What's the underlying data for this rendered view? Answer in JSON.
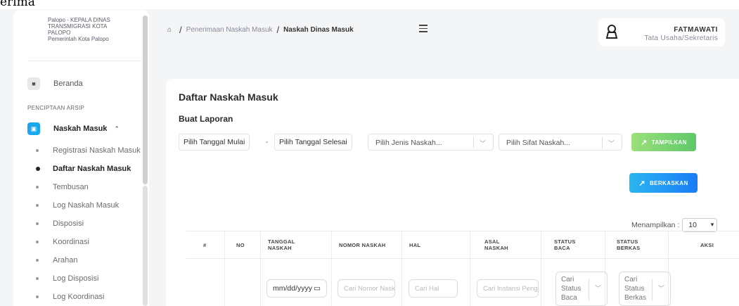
{
  "top_strip": "erima",
  "sidebar": {
    "org_lines": [
      "Palopo - KEPALA DINAS",
      "TRANSMIGRASI KOTA",
      "PALOPO",
      "Pemerintah Kota Palopo"
    ],
    "home_label": "Beranda",
    "section_title": "PENCIPTAAN ARSIP",
    "group_label": "Naskah Masuk",
    "items": [
      {
        "label": "Registrasi Naskah Masuk"
      },
      {
        "label": "Daftar Naskah Masuk"
      },
      {
        "label": "Tembusan"
      },
      {
        "label": "Log Naskah Masuk"
      },
      {
        "label": "Disposisi"
      },
      {
        "label": "Koordinasi"
      },
      {
        "label": "Arahan"
      },
      {
        "label": "Log Disposisi"
      },
      {
        "label": "Log Koordinasi"
      }
    ],
    "active_item": "Daftar Naskah Masuk"
  },
  "header": {
    "breadcrumb": [
      "Penerimaan Naskah Masuk",
      "Naskah Dinas Masuk"
    ],
    "user_name": "FATMAWATI",
    "user_role": "Tata Usaha/Sekretaris"
  },
  "main": {
    "title": "Daftar Naskah Masuk",
    "report_title": "Buat Laporan",
    "start_date": "Pilih Tanggal Mulai",
    "dash": "-",
    "end_date": "Pilih Tanggal Selesai",
    "jenis_placeholder": "Pilih Jenis Naskah...",
    "sifat_placeholder": "Pilih Sifat Naskah...",
    "show_button": "TAMPILKAN",
    "file_button": "BERKASKAN",
    "showing_label": "Menampilkan :",
    "page_size": "10"
  },
  "table": {
    "columns": [
      "#",
      "NO",
      "TANGGAL NASKAH",
      "NOMOR NASKAH",
      "HAL",
      "ASAL NASKAH",
      "STATUS BACA",
      "STATUS BERKAS",
      "AKSI"
    ],
    "filters": {
      "date": "mm/dd/yyyy",
      "nomor": "Cari Nomor Naskah",
      "hal": "Cari Hal",
      "asal": "Cari Instansi Pengirim",
      "status_baca": "Cari Status Baca",
      "status_berkas": "Cari Status Berkas"
    }
  }
}
